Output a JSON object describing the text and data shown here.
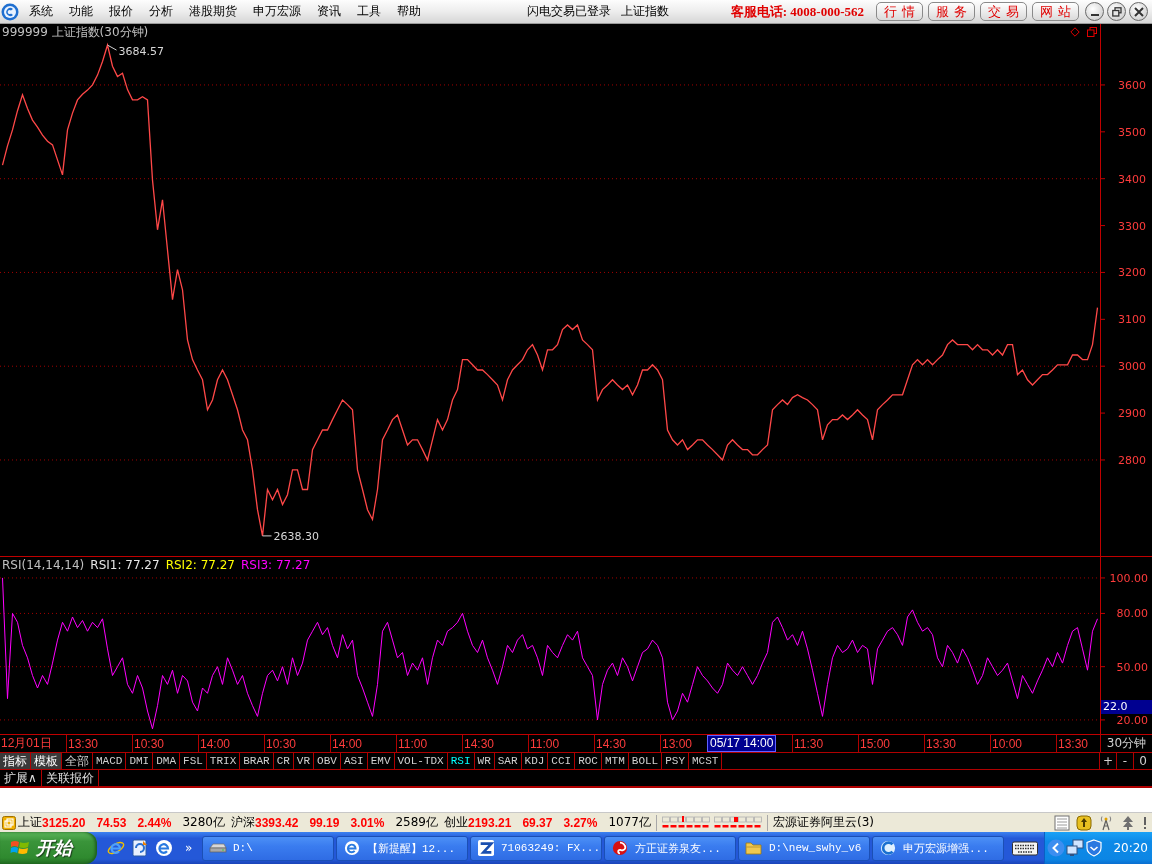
{
  "menu_bar": {
    "items": [
      "系统",
      "功能",
      "报价",
      "分析",
      "港股期货",
      "申万宏源",
      "资讯",
      "工具",
      "帮助"
    ],
    "login_status": "闪电交易已登录",
    "index_name": "上证指数",
    "hotline": "客服电话: 4008-000-562",
    "quick_buttons": [
      "行 情",
      "服 务",
      "交 易",
      "网 站"
    ]
  },
  "price_panel": {
    "title": "999999 上证指数(30分钟)",
    "chart_data": {
      "type": "line",
      "ylim": [
        2593,
        3730
      ],
      "yticks": [
        2800,
        2900,
        3000,
        3100,
        3200,
        3300,
        3400,
        3500,
        3600
      ],
      "grid": true,
      "series": [
        {
          "color": "#ff4848",
          "values": [
            3429,
            3470,
            3504,
            3545,
            3579,
            3550,
            3525,
            3510,
            3493,
            3480,
            3472,
            3440,
            3408,
            3504,
            3540,
            3568,
            3580,
            3589,
            3600,
            3621,
            3650,
            3685,
            3640,
            3618,
            3625,
            3590,
            3568,
            3568,
            3575,
            3568,
            3397,
            3291,
            3355,
            3248,
            3142,
            3206,
            3163,
            3056,
            3014,
            2992,
            2971,
            2907,
            2928,
            2971,
            2992,
            2971,
            2939,
            2907,
            2864,
            2843,
            2779,
            2694,
            2638,
            2737,
            2715,
            2737,
            2705,
            2726,
            2779,
            2779,
            2737,
            2737,
            2822,
            2843,
            2864,
            2864,
            2886,
            2907,
            2928,
            2918,
            2907,
            2779,
            2737,
            2694,
            2673,
            2737,
            2843,
            2864,
            2886,
            2896,
            2864,
            2832,
            2843,
            2843,
            2822,
            2800,
            2843,
            2886,
            2864,
            2886,
            2928,
            2950,
            3014,
            3014,
            3003,
            2992,
            2992,
            2982,
            2971,
            2960,
            2928,
            2971,
            2992,
            3003,
            3014,
            3035,
            3046,
            3024,
            2992,
            3035,
            3035,
            3046,
            3078,
            3088,
            3078,
            3088,
            3056,
            3046,
            3035,
            2928,
            2950,
            2960,
            2971,
            2960,
            2950,
            2960,
            2939,
            2960,
            2992,
            2992,
            3003,
            2992,
            2971,
            2864,
            2843,
            2832,
            2843,
            2822,
            2832,
            2843,
            2843,
            2832,
            2822,
            2811,
            2800,
            2832,
            2843,
            2832,
            2822,
            2822,
            2811,
            2811,
            2822,
            2832,
            2907,
            2918,
            2928,
            2918,
            2933,
            2939,
            2933,
            2928,
            2918,
            2907,
            2843,
            2875,
            2886,
            2886,
            2896,
            2886,
            2896,
            2907,
            2896,
            2886,
            2843,
            2907,
            2918,
            2928,
            2939,
            2939,
            2939,
            2971,
            3003,
            3014,
            3003,
            3014,
            3003,
            3014,
            3024,
            3046,
            3056,
            3046,
            3046,
            3046,
            3035,
            3046,
            3035,
            3035,
            3024,
            3035,
            3024,
            3046,
            3046,
            2982,
            2992,
            2971,
            2960,
            2971,
            2982,
            2982,
            2992,
            3003,
            3003,
            3003,
            3024,
            3024,
            3014,
            3014,
            3046,
            3125
          ]
        }
      ],
      "annotations": [
        "3684.57",
        "2638.30"
      ]
    }
  },
  "rsi_panel": {
    "title": "RSI(14,14,14)",
    "legend": [
      {
        "text": "RSI1: 77.27",
        "color": "#e6e6e6"
      },
      {
        "text": "RSI2: 77.27",
        "color": "#ffff00"
      },
      {
        "text": "RSI3: 77.27",
        "color": "#ff00ff"
      }
    ],
    "cursor_value": "22.0",
    "chart_data": {
      "type": "line",
      "ylim": [
        11.5,
        111.8
      ],
      "yticks": [
        {
          "value": 20,
          "label": "20.00"
        },
        {
          "value": 50,
          "label": "50.00"
        },
        {
          "value": 80,
          "label": "80.00"
        },
        {
          "value": 100,
          "label": "100.00"
        }
      ],
      "grid": true,
      "series": [
        {
          "color": "#ff00ff",
          "values": [
            100,
            32,
            80,
            75,
            62,
            55,
            45,
            38,
            45,
            40,
            52,
            65,
            75,
            70,
            78,
            72,
            76,
            70,
            75,
            72,
            77,
            60,
            45,
            50,
            55,
            40,
            35,
            45,
            38,
            25,
            15,
            28,
            45,
            40,
            48,
            35,
            45,
            42,
            30,
            25,
            38,
            35,
            45,
            50,
            40,
            55,
            48,
            40,
            45,
            35,
            28,
            22,
            35,
            45,
            48,
            42,
            50,
            40,
            55,
            45,
            52,
            65,
            70,
            75,
            68,
            72,
            62,
            55,
            68,
            60,
            65,
            45,
            38,
            30,
            22,
            40,
            70,
            75,
            65,
            55,
            58,
            45,
            52,
            48,
            55,
            40,
            55,
            65,
            62,
            70,
            72,
            75,
            80,
            70,
            62,
            58,
            65,
            55,
            48,
            40,
            50,
            62,
            58,
            65,
            68,
            60,
            62,
            55,
            45,
            62,
            58,
            55,
            62,
            68,
            65,
            70,
            55,
            50,
            45,
            20,
            40,
            48,
            52,
            45,
            55,
            50,
            42,
            50,
            58,
            60,
            65,
            62,
            55,
            30,
            20,
            25,
            35,
            30,
            40,
            50,
            45,
            42,
            38,
            35,
            40,
            52,
            48,
            45,
            50,
            45,
            40,
            45,
            52,
            58,
            75,
            78,
            72,
            65,
            68,
            62,
            70,
            60,
            48,
            35,
            22,
            40,
            55,
            62,
            58,
            60,
            65,
            58,
            62,
            60,
            40,
            60,
            65,
            70,
            72,
            68,
            62,
            78,
            82,
            75,
            70,
            72,
            68,
            55,
            50,
            62,
            58,
            52,
            60,
            55,
            48,
            40,
            45,
            55,
            50,
            45,
            48,
            52,
            42,
            32,
            45,
            40,
            35,
            42,
            48,
            55,
            50,
            58,
            52,
            62,
            70,
            72,
            60,
            48,
            70,
            77
          ]
        }
      ]
    }
  },
  "time_axis": {
    "labels": [
      {
        "text": "12月01日",
        "kind": "tick"
      },
      {
        "text": "13:30",
        "kind": "tick"
      },
      {
        "text": "10:30",
        "kind": "tick"
      },
      {
        "text": "14:00",
        "kind": "tick"
      },
      {
        "text": "10:30",
        "kind": "tick"
      },
      {
        "text": "14:00",
        "kind": "tick"
      },
      {
        "text": "11:00",
        "kind": "tick"
      },
      {
        "text": "14:30",
        "kind": "tick"
      },
      {
        "text": "11:00",
        "kind": "tick"
      },
      {
        "text": "14:30",
        "kind": "tick"
      },
      {
        "text": "13:00",
        "kind": "tick"
      },
      {
        "text": "05/17 14:00",
        "kind": "cursor"
      },
      {
        "text": "11:30",
        "kind": "tick"
      },
      {
        "text": "15:00",
        "kind": "tick"
      },
      {
        "text": "13:30",
        "kind": "tick"
      },
      {
        "text": "10:00",
        "kind": "tick"
      },
      {
        "text": "13:30",
        "kind": "tick"
      }
    ],
    "period": "30分钟"
  },
  "indicator_bar": {
    "mode_tabs": [
      "指标",
      "模板"
    ],
    "tabs": [
      {
        "label": "全部",
        "selected": false
      },
      {
        "label": "MACD",
        "selected": false
      },
      {
        "label": "DMI",
        "selected": false
      },
      {
        "label": "DMA",
        "selected": false
      },
      {
        "label": "FSL",
        "selected": false
      },
      {
        "label": "TRIX",
        "selected": false
      },
      {
        "label": "BRAR",
        "selected": false
      },
      {
        "label": "CR",
        "selected": false
      },
      {
        "label": "VR",
        "selected": false
      },
      {
        "label": "OBV",
        "selected": false
      },
      {
        "label": "ASI",
        "selected": false
      },
      {
        "label": "EMV",
        "selected": false
      },
      {
        "label": "VOL-TDX",
        "selected": false
      },
      {
        "label": "RSI",
        "selected": true
      },
      {
        "label": "WR",
        "selected": false
      },
      {
        "label": "SAR",
        "selected": false
      },
      {
        "label": "KDJ",
        "selected": false
      },
      {
        "label": "CCI",
        "selected": false
      },
      {
        "label": "ROC",
        "selected": false
      },
      {
        "label": "MTM",
        "selected": false
      },
      {
        "label": "BOLL",
        "selected": false
      },
      {
        "label": "PSY",
        "selected": false
      },
      {
        "label": "MCST",
        "selected": false
      }
    ],
    "zoom_buttons": [
      "+",
      "-",
      "0"
    ],
    "extra_buttons": [
      "扩展∧",
      "关联报价"
    ]
  },
  "status_bar": {
    "indices": [
      {
        "name": "上证",
        "value": "3125.20",
        "change": "74.53",
        "percent": "2.44%",
        "amount": "3280亿",
        "rising": true
      },
      {
        "name": "沪深",
        "value": "3393.42",
        "change": "99.19",
        "percent": "3.01%",
        "amount": "2589亿",
        "rising": true
      },
      {
        "name": "创业",
        "value": "2193.21",
        "change": "69.37",
        "percent": "3.27%",
        "amount": "1077亿",
        "rising": true
      }
    ],
    "server": "宏源证券阿里云(3)"
  },
  "taskbar": {
    "start": "开始",
    "more": "»",
    "tasks": [
      "D:\\",
      "【新提醒】12...",
      "71063249: FX...",
      "方正证券泉友...",
      "D:\\new_swhy_v6",
      "申万宏源增强..."
    ],
    "clock": "20:20"
  }
}
